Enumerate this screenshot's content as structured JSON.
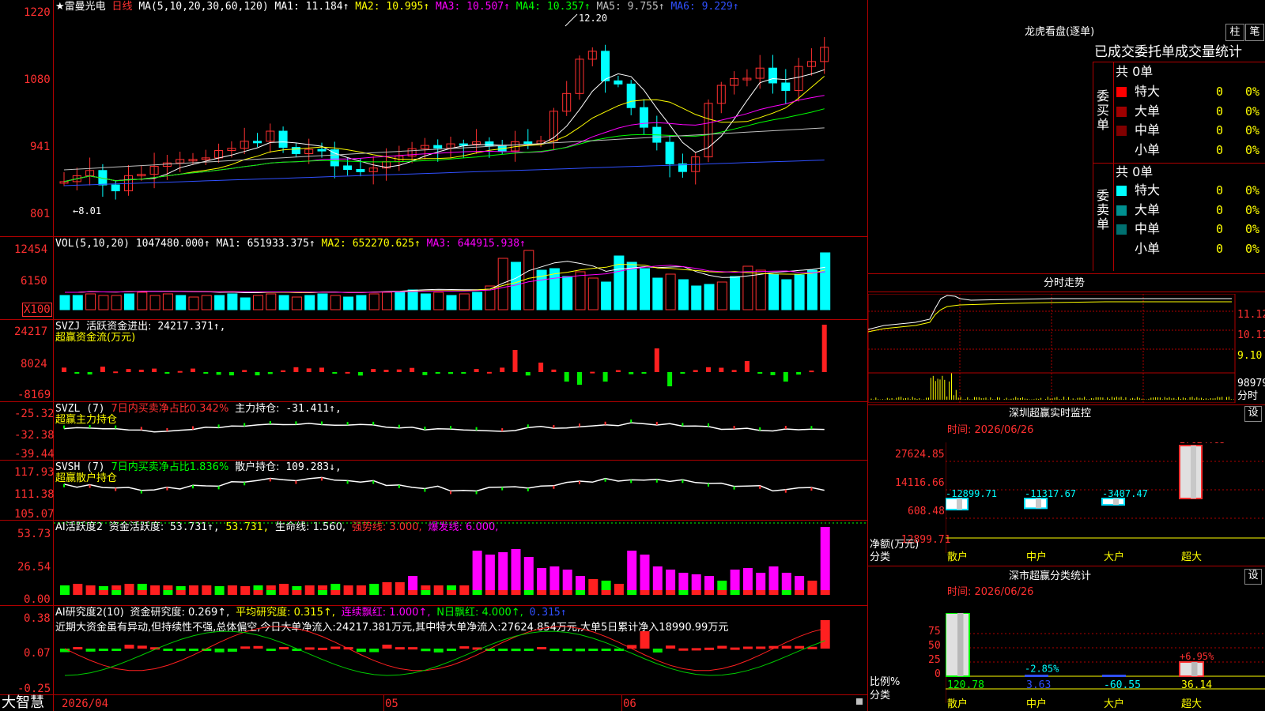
{
  "kline": {
    "title": "★雷曼光电",
    "period": "日线",
    "ma_label": "MA(5,10,20,30,60,120)",
    "ma_values": [
      {
        "label": "MA1:",
        "value": "11.184↑",
        "color": "#ffffff"
      },
      {
        "label": "MA2:",
        "value": "10.995↑",
        "color": "#ffff00"
      },
      {
        "label": "MA3:",
        "value": "10.507↑",
        "color": "#ff00ff"
      },
      {
        "label": "MA4:",
        "value": "10.357↑",
        "color": "#00ff00"
      },
      {
        "label": "MA5:",
        "value": "9.755↑",
        "color": "#c0c0c0"
      },
      {
        "label": "MA6:",
        "value": "9.229↑",
        "color": "#3050ff"
      }
    ],
    "y_ticks": [
      "1220",
      "1080",
      "941",
      "801"
    ],
    "high_label": "12.20",
    "low_label": "←8.01"
  },
  "vol": {
    "label": "VOL(5,10,20)",
    "value": "1047480.000↑",
    "ma": [
      {
        "label": "MA1:",
        "value": "651933.375↑",
        "color": "#ffffff"
      },
      {
        "label": "MA2:",
        "value": "652270.625↑",
        "color": "#ffff00"
      },
      {
        "label": "MA3:",
        "value": "644915.938↑",
        "color": "#ff00ff"
      }
    ],
    "y_ticks": [
      "12454",
      "6150"
    ],
    "unit": "X100"
  },
  "svzj": {
    "label": "SVZJ",
    "desc": "活跃资金进出:",
    "value": "24217.371↑,",
    "subtitle": "超赢资金流(万元)",
    "y_ticks": [
      "24217",
      "8024",
      "-8169"
    ]
  },
  "svzl": {
    "label": "SVZL (7)",
    "ratio": "7日内买卖净占比0.342%",
    "desc": "主力持仓:",
    "value": "-31.411↑,",
    "subtitle": "超赢主力持仓",
    "y_ticks": [
      "-25.32",
      "-32.38",
      "-39.44"
    ]
  },
  "svsh": {
    "label": "SVSH (7)",
    "ratio": "7日内买卖净占比1.836%",
    "desc": "散户持仓:",
    "value": "109.283↓,",
    "subtitle": "超赢散户持仓",
    "y_ticks": [
      "117.93",
      "111.38",
      "105.07"
    ]
  },
  "ai_active": {
    "label": "AI活跃度2",
    "desc": "资金活跃度:",
    "value": "53.731↑,",
    "value2": "53.731,",
    "life": "生命线: 1.560,",
    "strong": "强势线: 3.000,",
    "burst": "爆发线: 6.000,",
    "y_ticks": [
      "53.73",
      "26.54",
      "0.00"
    ]
  },
  "ai_research": {
    "label": "AI研究度2(10)",
    "desc": "资金研究度: 0.269↑,",
    "avg": "平均研究度: 0.315↑,",
    "streak": "连续飘红: 1.000↑,",
    "nday": "N日飘红: 4.000↑,",
    "last": "0.315↑",
    "comment": "近期大资金虽有异动,但持续性不强,总体偏空,今日大单净流入:24217.381万元,其中特大单净流入:27624.854万元,大单5日累计净入18990.99万元",
    "y_ticks": [
      "0.38",
      "0.07",
      "-0.25"
    ]
  },
  "x_axis": {
    "labels": [
      "2026/04",
      "05",
      "06"
    ]
  },
  "brand": "大智慧",
  "right": {
    "dragon_title": "龙虎看盘(逐单)",
    "btn_zhu": "柱",
    "btn_bi": "笔",
    "stats_title": "已成交委托单成交量统计",
    "buy": {
      "label": "委买单",
      "total": "共 0单",
      "rows": [
        {
          "name": "特大",
          "value": "0",
          "pct": "0%",
          "color": "#ff0000"
        },
        {
          "name": "大单",
          "value": "0",
          "pct": "0%",
          "color": "#a00000"
        },
        {
          "name": "中单",
          "value": "0",
          "pct": "0%",
          "color": "#800000"
        },
        {
          "name": "小单",
          "value": "0",
          "pct": "0%",
          "color": ""
        }
      ]
    },
    "sell": {
      "label": "委卖单",
      "total": "共 0单",
      "rows": [
        {
          "name": "特大",
          "value": "0",
          "pct": "0%",
          "color": "#00ffff"
        },
        {
          "name": "大单",
          "value": "0",
          "pct": "0%",
          "color": "#009090"
        },
        {
          "name": "中单",
          "value": "0",
          "pct": "0%",
          "color": "#007070"
        },
        {
          "name": "小单",
          "value": "0",
          "pct": "0%",
          "color": ""
        }
      ]
    },
    "fenshi": {
      "title": "分时走势",
      "y_ticks": [
        "11.12",
        "10.11",
        "9.10",
        "98979"
      ],
      "fenshi_label": "分时"
    },
    "monitor": {
      "title": "深圳超赢实时监控",
      "btn": "设",
      "time": "时间: 2026/06/26",
      "y_ticks": [
        "27624.85",
        "14116.66",
        "608.48",
        "-12899.71"
      ],
      "ylabel": "净额(万元)",
      "xlabel": "分类",
      "categories": [
        "散户",
        "中户",
        "大户",
        "超大"
      ],
      "values": [
        -12899.71,
        -11317.67,
        -3407.47,
        27624.85
      ],
      "value_labels": [
        "-12899.71",
        "-11317.67",
        "-3407.47",
        "27624.85"
      ]
    },
    "classify": {
      "title": "深市超赢分类统计",
      "btn": "设",
      "time": "时间: 2026/06/26",
      "y_ticks": [
        "75",
        "50",
        "25",
        "0"
      ],
      "ylabel": "比例%",
      "xlabel": "分类",
      "categories": [
        "散户",
        "中户",
        "大户",
        "超大"
      ],
      "pct_labels": [
        "",
        "-2.85%",
        "",
        "+6.95%"
      ],
      "bottom_labels": [
        "120.78",
        "3.63",
        "-60.55",
        "36.14"
      ]
    }
  },
  "chart_data": [
    {
      "type": "bar",
      "title": "深圳超赢实时监控",
      "categories": [
        "散户",
        "中户",
        "大户",
        "超大"
      ],
      "values": [
        -12899.71,
        -11317.67,
        -3407.47,
        27624.85
      ],
      "ylabel": "净额(万元)",
      "xlabel": "分类",
      "ylim": [
        -12899.71,
        27624.85
      ]
    },
    {
      "type": "bar",
      "title": "深市超赢分类统计",
      "categories": [
        "散户",
        "中户",
        "大户",
        "超大"
      ],
      "values": [
        120.78,
        3.63,
        -60.55,
        36.14
      ],
      "ylabel": "比例%",
      "xlabel": "分类"
    }
  ]
}
